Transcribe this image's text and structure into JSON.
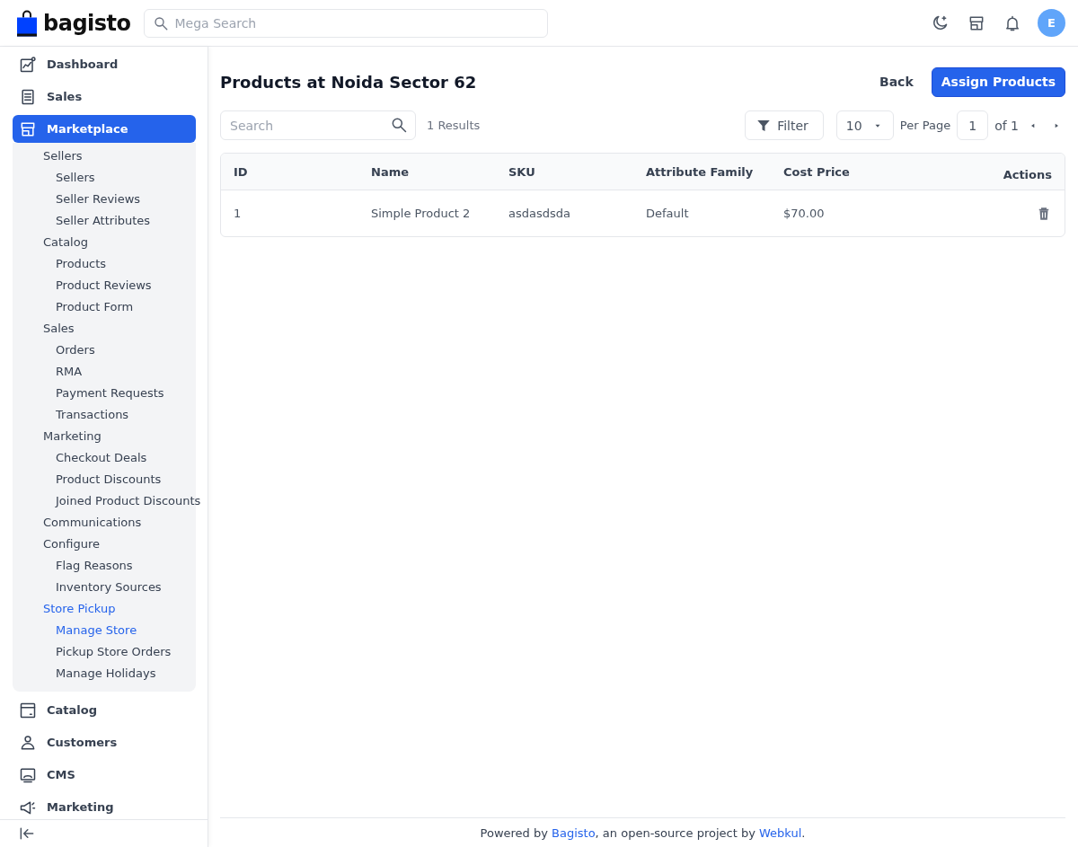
{
  "header": {
    "logo": "bagisto",
    "search": {
      "placeholder": "Mega Search"
    },
    "avatar": "E"
  },
  "sidebar": {
    "items": [
      {
        "label": "Dashboard",
        "selected": false
      },
      {
        "label": "Sales",
        "selected": false
      },
      {
        "label": "Marketplace",
        "selected": true,
        "expanded": true,
        "children": [
          {
            "label": "Sellers",
            "selected": false,
            "children": [
              {
                "label": "Sellers",
                "selected": false
              },
              {
                "label": "Seller Reviews",
                "selected": false
              },
              {
                "label": "Seller Attributes",
                "selected": false
              }
            ]
          },
          {
            "label": "Catalog",
            "selected": false,
            "children": [
              {
                "label": "Products",
                "selected": false
              },
              {
                "label": "Product Reviews",
                "selected": false
              },
              {
                "label": "Product Form",
                "selected": false
              }
            ]
          },
          {
            "label": "Sales",
            "selected": false,
            "children": [
              {
                "label": "Orders",
                "selected": false
              },
              {
                "label": "RMA",
                "selected": false
              },
              {
                "label": "Payment Requests",
                "selected": false
              },
              {
                "label": "Transactions",
                "selected": false
              }
            ]
          },
          {
            "label": "Marketing",
            "selected": false,
            "children": [
              {
                "label": "Checkout Deals",
                "selected": false
              },
              {
                "label": "Product Discounts",
                "selected": false
              },
              {
                "label": "Joined Product Discounts",
                "selected": false
              }
            ]
          },
          {
            "label": "Communications",
            "selected": false
          },
          {
            "label": "Configure",
            "selected": false,
            "children": [
              {
                "label": "Flag Reasons",
                "selected": false
              },
              {
                "label": "Inventory Sources",
                "selected": false
              }
            ]
          },
          {
            "label": "Store Pickup",
            "selected": true,
            "children": [
              {
                "label": "Manage Store",
                "selected": true
              },
              {
                "label": "Pickup Store Orders",
                "selected": false
              },
              {
                "label": "Manage Holidays",
                "selected": false
              }
            ]
          }
        ]
      },
      {
        "label": "Catalog",
        "selected": false
      },
      {
        "label": "Customers",
        "selected": false
      },
      {
        "label": "CMS",
        "selected": false
      },
      {
        "label": "Marketing",
        "selected": false
      }
    ]
  },
  "page": {
    "title": "Products at Noida Sector 62",
    "back": "Back",
    "primary": "Assign Products"
  },
  "toolbar": {
    "search": {
      "placeholder": "Search"
    },
    "results": "1 Results",
    "filter": "Filter",
    "per_page": "10",
    "per_page_label": "Per Page",
    "page": "1",
    "page_total": "of 1"
  },
  "table": {
    "columns": [
      "ID",
      "Name",
      "SKU",
      "Attribute Family",
      "Cost Price",
      "Actions"
    ],
    "rows": [
      {
        "cells": [
          "1",
          "Simple Product 2",
          "asdasdsda",
          "Default",
          "$70.00"
        ]
      }
    ]
  },
  "footer": {
    "parts": [
      {
        "kind": "text",
        "text": "Powered by "
      },
      {
        "kind": "link",
        "text": "Bagisto"
      },
      {
        "kind": "text",
        "text": ", an open-source project by "
      },
      {
        "kind": "link",
        "text": "Webkul"
      },
      {
        "kind": "text",
        "text": "."
      }
    ]
  }
}
